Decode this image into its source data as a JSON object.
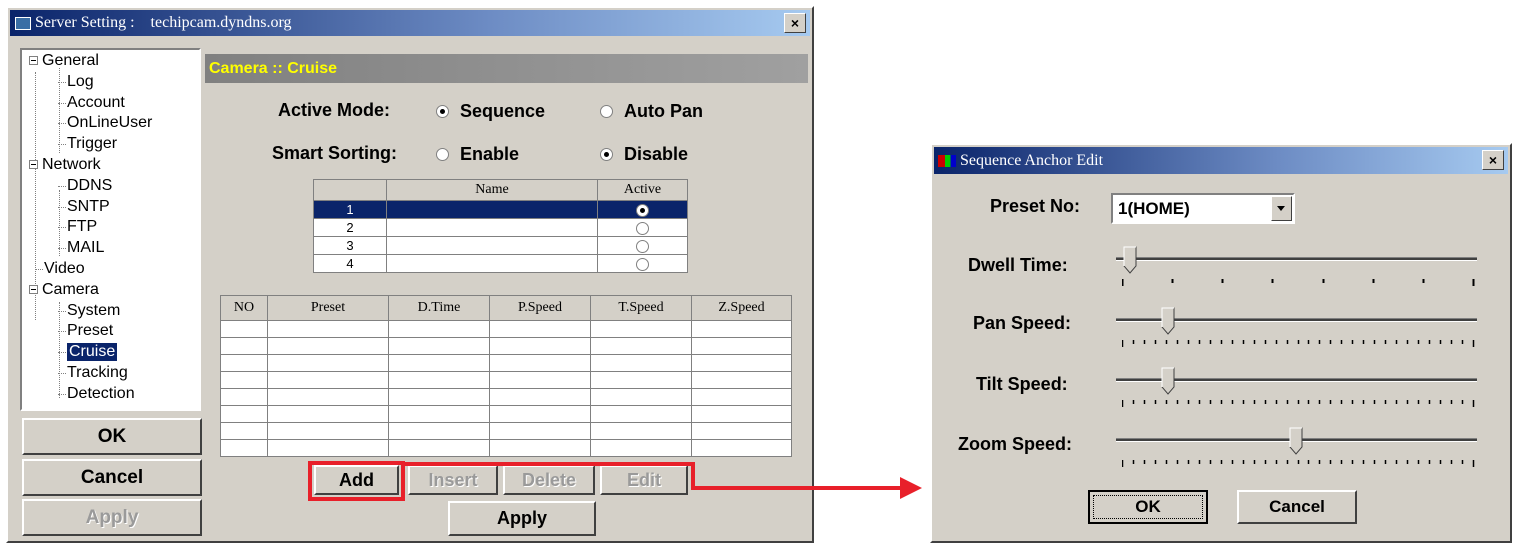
{
  "server_window": {
    "title": "Server Setting :    techipcam.dyndns.org",
    "close_glyph": "×",
    "tree": [
      {
        "label": "General",
        "level": 0,
        "expander": true
      },
      {
        "label": "Log",
        "level": 1
      },
      {
        "label": "Account",
        "level": 1
      },
      {
        "label": "OnLineUser",
        "level": 1
      },
      {
        "label": "Trigger",
        "level": 1
      },
      {
        "label": "Network",
        "level": 0,
        "expander": true
      },
      {
        "label": "DDNS",
        "level": 1
      },
      {
        "label": "SNTP",
        "level": 1
      },
      {
        "label": "FTP",
        "level": 1
      },
      {
        "label": "MAIL",
        "level": 1
      },
      {
        "label": "Video",
        "level": 0
      },
      {
        "label": "Camera",
        "level": 0,
        "expander": true
      },
      {
        "label": "System",
        "level": 1
      },
      {
        "label": "Preset",
        "level": 1
      },
      {
        "label": "Cruise",
        "level": 1,
        "selected": true
      },
      {
        "label": "Tracking",
        "level": 1
      },
      {
        "label": "Detection",
        "level": 1
      }
    ],
    "ok_label": "OK",
    "cancel_label": "Cancel",
    "apply_label": "Apply",
    "panel_title": "Camera :: Cruise",
    "active_mode": {
      "label": "Active Mode:",
      "options": [
        "Sequence",
        "Auto Pan"
      ],
      "selected": "Sequence"
    },
    "smart_sorting": {
      "label": "Smart Sorting:",
      "options": [
        "Enable",
        "Disable"
      ],
      "selected": "Disable"
    },
    "sequence_table": {
      "headers": [
        "",
        "Name",
        "Active"
      ],
      "rows": [
        {
          "no": "1",
          "name": "",
          "active": true,
          "selected": true
        },
        {
          "no": "2",
          "name": "",
          "active": false
        },
        {
          "no": "3",
          "name": "",
          "active": false
        },
        {
          "no": "4",
          "name": "",
          "active": false
        }
      ]
    },
    "cruise_table": {
      "headers": [
        "NO",
        "Preset",
        "D.Time",
        "P.Speed",
        "T.Speed",
        "Z.Speed"
      ],
      "empty_rows": 8
    },
    "add_label": "Add",
    "insert_label": "Insert",
    "delete_label": "Delete",
    "edit_label": "Edit",
    "panel_apply_label": "Apply"
  },
  "anchor_dialog": {
    "title": "Sequence Anchor Edit",
    "close_glyph": "×",
    "preset_label": "Preset No:",
    "preset_value": "1(HOME)",
    "dwell_label": "Dwell Time:",
    "dwell_level": 0.02,
    "pan_label": "Pan Speed:",
    "pan_level": 0.13,
    "tilt_label": "Tilt Speed:",
    "tilt_level": 0.13,
    "zoom_label": "Zoom Speed:",
    "zoom_level": 0.5,
    "ok_label": "OK",
    "cancel_label": "Cancel"
  },
  "colors": {
    "highlight": "#e8202a",
    "panel_title_text": "#ffff00",
    "selection": "#0a246a"
  }
}
